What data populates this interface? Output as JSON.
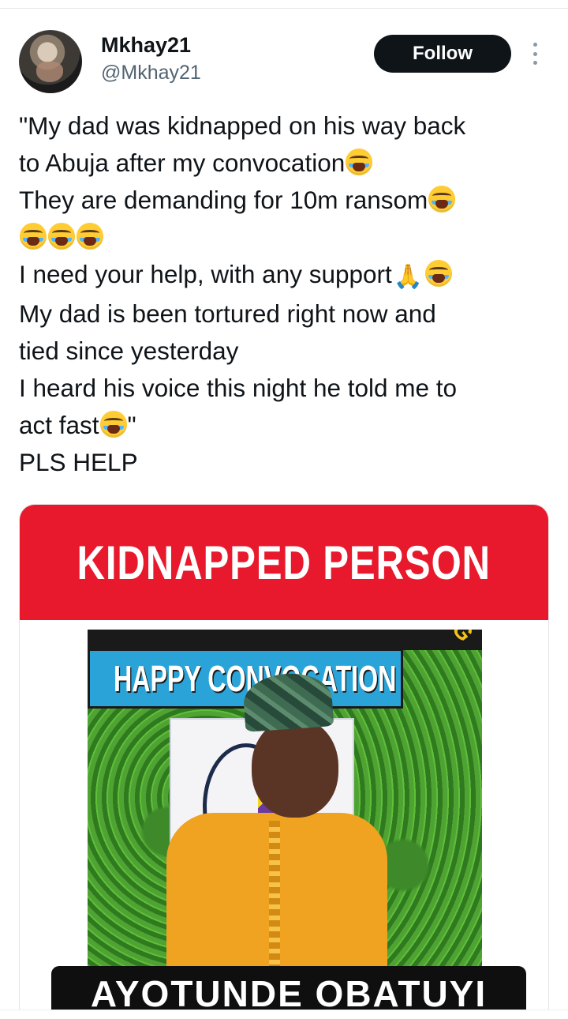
{
  "author": {
    "display_name": "Mkhay21",
    "handle": "@Mkhay21",
    "follow_label": "Follow"
  },
  "tweet": {
    "line1": "\"My dad was kidnapped on his way back",
    "line2": "to Abuja after my convocation",
    "line3": "They are demanding for 10m ransom",
    "line5": "I need your help, with any support",
    "line6": "My dad is been tortured right now and",
    "line7": "tied since yesterday",
    "line8": "I heard his voice this night he told me to",
    "line9a": "act fast",
    "line9b": "\"",
    "line10": "PLS HELP"
  },
  "image_card": {
    "banner": "KIDNAPPED PERSON",
    "photo_banner": "HAPPY CONVOCATION",
    "photo_arc_text": "NOLOG",
    "name_plate": "AYOTUNDE OBATUYI"
  },
  "icons": {
    "crying_emoji": "loudly-crying-face-icon",
    "pray_emoji": "folded-hands-icon",
    "more": "more-options-icon"
  },
  "colors": {
    "banner_red": "#e8192c",
    "follow_bg": "#0f1419",
    "handle_gray": "#536471"
  }
}
